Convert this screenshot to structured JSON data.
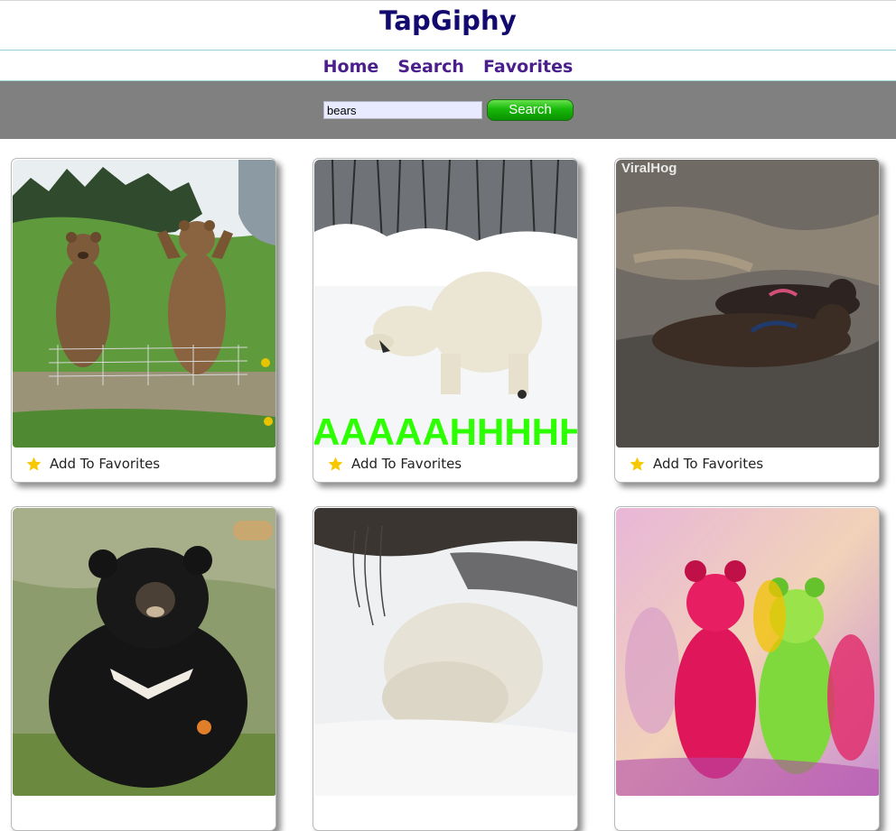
{
  "app": {
    "title": "TapGiphy"
  },
  "nav": {
    "items": [
      {
        "label": "Home"
      },
      {
        "label": "Search"
      },
      {
        "label": "Favorites"
      }
    ]
  },
  "search": {
    "value": "bears",
    "placeholder": "",
    "button_label": "Search"
  },
  "results": [
    {
      "fav_label": "Add To Favorites",
      "icon": "star-icon",
      "scene": "two brown bears standing behind a fence in a grassy field"
    },
    {
      "fav_label": "Add To Favorites",
      "icon": "star-icon",
      "scene": "polar bear in the snow",
      "caption": "AAAAAHHHHHH"
    },
    {
      "fav_label": "Add To Favorites",
      "icon": "star-icon",
      "scene": "two bear cubs running on rocks",
      "watermark": "ViralHog"
    },
    {
      "fav_label": "",
      "icon": "star-icon",
      "scene": "black bear sitting holding a carrot"
    },
    {
      "fav_label": "",
      "icon": "star-icon",
      "scene": "polar bear digging in snow"
    },
    {
      "fav_label": "",
      "icon": "star-icon",
      "scene": "red and green gummy bears"
    }
  ],
  "colors": {
    "title": "#120a6e",
    "nav_link": "#4a1f8c",
    "search_bar_bg": "#808080",
    "button_green": "#18b80a",
    "star": "#f5c800"
  }
}
